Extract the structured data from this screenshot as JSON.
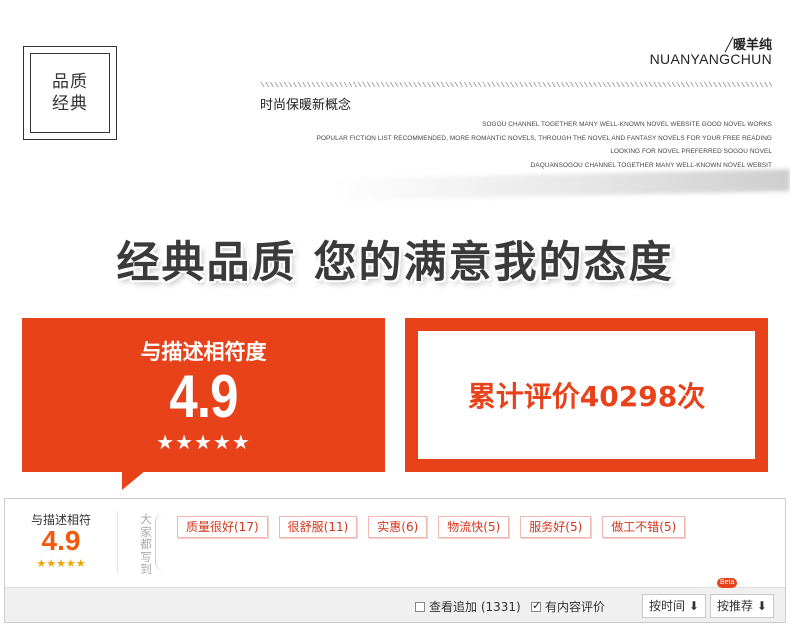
{
  "header": {
    "logo_line1": "品质",
    "logo_line2": "经典",
    "brand_zh": "╱暖羊纯",
    "brand_en": "NUANYANGCHUN",
    "slogan": "时尚保暖新概念",
    "desc_lines": [
      "SOGOU CHANNEL TOGETHER MANY WELL-KNOWN NOVEL WEBSITE GOOD NOVEL WORKS",
      "POPULAR FICTION LIST RECOMMENDED, MORE ROMANTIC NOVELS, THROUGH THE NOVEL AND FANTASY NOVELS FOR YOUR FREE READING",
      "LOOKING FOR NOVEL PREFERRED SOGOU NOVEL",
      "DAQUANSOGOU CHANNEL TOGETHER MANY WELL-KNOWN NOVEL WEBSIT"
    ]
  },
  "headline": "经典品质  您的满意我的态度",
  "rating_box": {
    "title": "与描述相符度",
    "score": "4.9",
    "stars": "★★★★★"
  },
  "count_box": {
    "text": "累计评价40298次"
  },
  "reviews": {
    "summary_label": "与描述相符",
    "summary_score": "4.9",
    "summary_stars": "★★★★★",
    "vertical_label": "大家都写到",
    "tags": [
      "质量很好(17)",
      "很舒服(11)",
      "实惠(6)",
      "物流快(5)",
      "服务好(5)",
      "做工不错(5)"
    ],
    "filter_append": "查看追加 (1331)",
    "filter_content": "有内容评价",
    "sort_time": "按时间",
    "sort_recommend": "按推荐",
    "beta": "Beta"
  },
  "colors": {
    "accent": "#e8421a",
    "star": "#f0a500",
    "score_orange": "#f05a0a"
  }
}
